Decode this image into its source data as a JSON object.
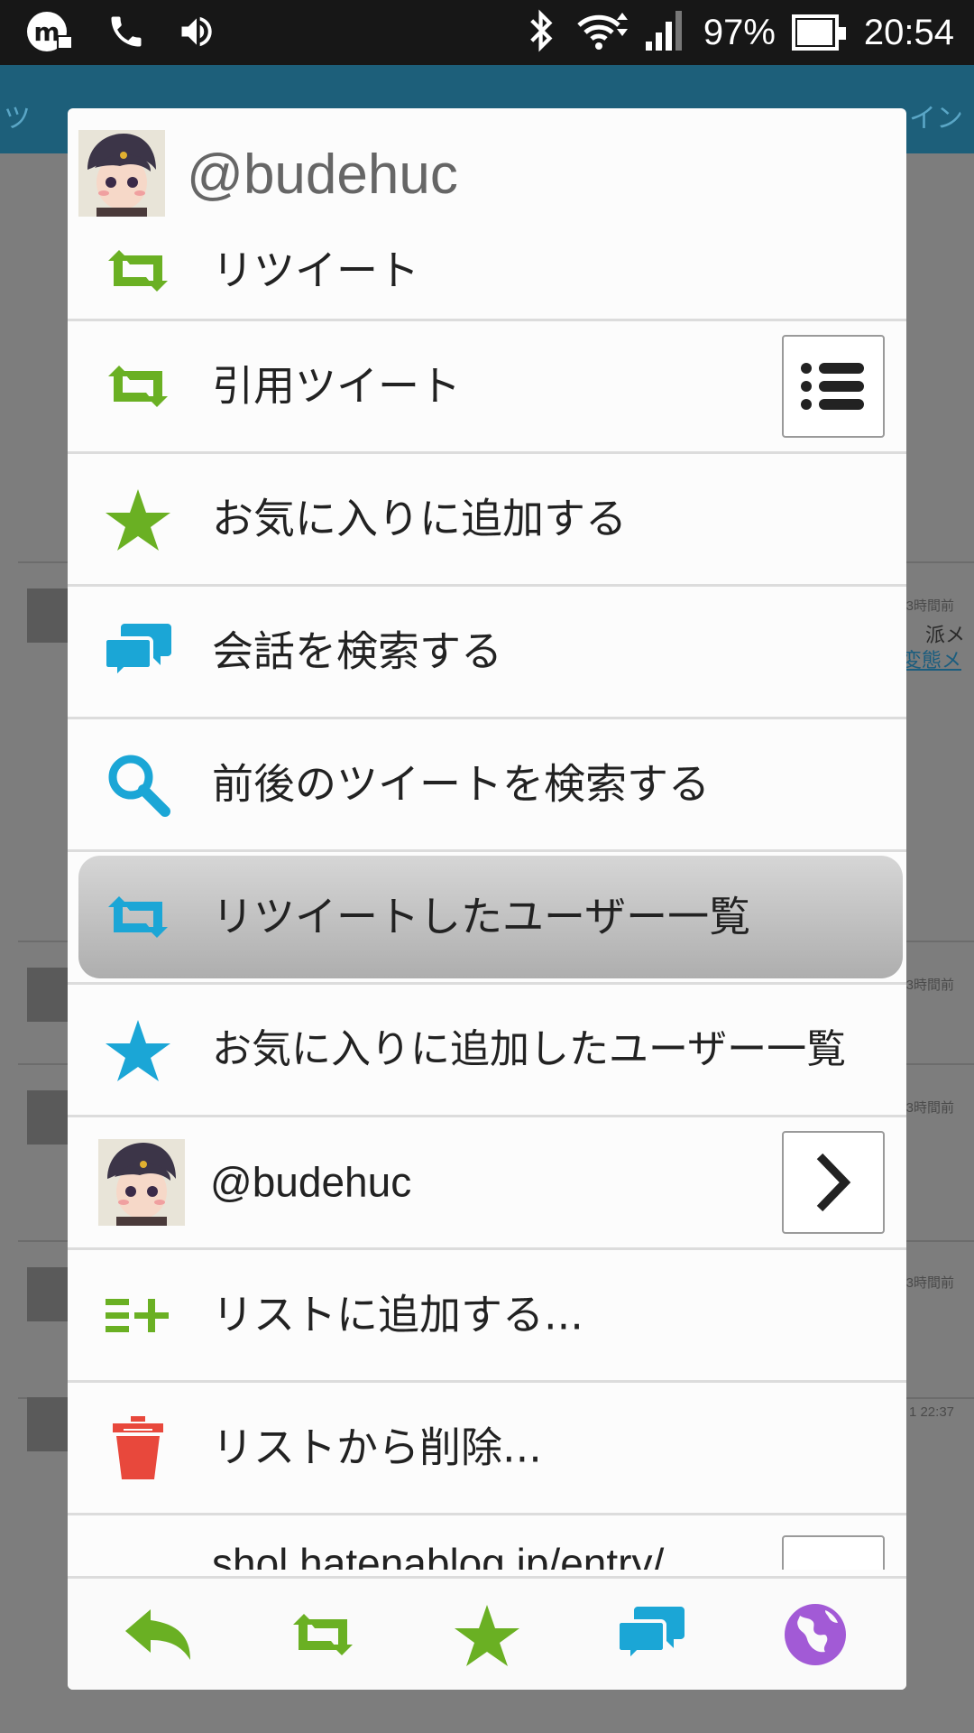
{
  "status_bar": {
    "battery": "97%",
    "time": "20:54",
    "battery_level": 0.97
  },
  "background": {
    "tabs": [
      "ツ",
      "イン"
    ],
    "times": [
      "3時間前",
      "3時間前",
      "3時間前",
      "3時間前",
      "1 22:37"
    ],
    "snippet_line1": "派メ",
    "snippet_line2": "変態メ"
  },
  "dialog": {
    "title": "@budehuc",
    "items": [
      {
        "label": "リツイート",
        "icon": "retweet-icon"
      },
      {
        "label": "引用ツイート",
        "icon": "retweet-icon",
        "side_icon": "list-icon"
      },
      {
        "label": "お気に入りに追加する",
        "icon": "star-icon"
      },
      {
        "label": "会話を検索する",
        "icon": "conversation-icon"
      },
      {
        "label": "前後のツイートを検索する",
        "icon": "search-icon"
      },
      {
        "label": "リツイートしたユーザー一覧",
        "icon": "retweet-icon"
      },
      {
        "label": "お気に入りに追加したユーザー一覧",
        "icon": "star-icon"
      },
      {
        "label": "@budehuc",
        "icon": "avatar",
        "side_icon": "chevron-right-icon"
      },
      {
        "label": "リストに追加する...",
        "icon": "list-add-icon"
      },
      {
        "label": "リストから削除...",
        "icon": "trash-icon"
      },
      {
        "label": "shol hatenablog.jp/entry/",
        "icon": "link-icon"
      }
    ],
    "bottom_actions": [
      "reply-icon",
      "retweet-icon",
      "star-icon",
      "conversation-icon",
      "globe-icon"
    ]
  },
  "colors": {
    "green": "#6ab023",
    "blue": "#1ba6d6",
    "red": "#e8483c",
    "purple": "#a25ad6"
  }
}
